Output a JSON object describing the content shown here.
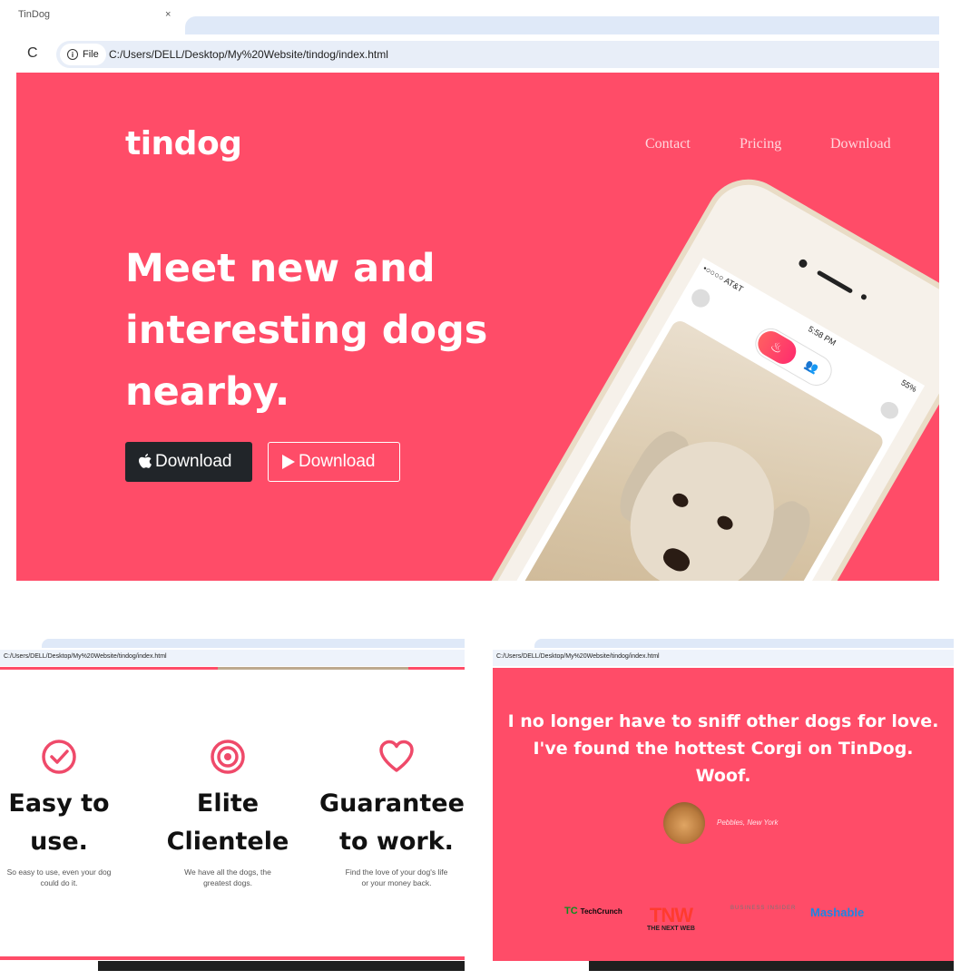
{
  "top": {
    "tab_title": "TinDog",
    "tab_close": "×",
    "reload_icon": "C",
    "file_label": "File",
    "url": "C:/Users/DELL/Desktop/My%20Website/tindog/index.html",
    "brand": "tindog",
    "nav": [
      "Contact",
      "Pricing",
      "Download"
    ],
    "headline": "Meet new and interesting dogs nearby.",
    "btn_apple": "Download",
    "btn_play": "Download",
    "phone": {
      "carrier": "•○○○○ AT&T",
      "time": "5:58 PM",
      "battery": "55%"
    }
  },
  "features": {
    "url": "C:/Users/DELL/Desktop/My%20Website/tindog/index.html",
    "items": [
      {
        "icon": "check-circle-icon",
        "title_1": "Easy to",
        "title_2": "use.",
        "text_1": "So easy to use, even your dog",
        "text_2": "could do it."
      },
      {
        "icon": "bullseye-icon",
        "title_1": "Elite",
        "title_2": "Clientele",
        "text_1": "We have all the dogs, the",
        "text_2": "greatest dogs."
      },
      {
        "icon": "heart-icon",
        "title_1": "Guaranteed",
        "title_2": "to work.",
        "text_1": "Find the love of your dog's life",
        "text_2": "or your money back."
      }
    ]
  },
  "testimonial": {
    "url": "C:/Users/DELL/Desktop/My%20Website/tindog/index.html",
    "quote": "I no longer have to sniff other dogs for love. I've found the hottest Corgi on TinDog. Woof.",
    "cite": "Pebbles, New York",
    "press": {
      "techcrunch_mark": "TC",
      "techcrunch": "TechCrunch",
      "tnw": "TNW",
      "tnw_sub": "THE NEXT WEB",
      "business_insider": "BUSINESS INSIDER",
      "mashable": "Mashable"
    }
  },
  "colors": {
    "brand": "#ff4c68",
    "dark_button": "#212529"
  }
}
